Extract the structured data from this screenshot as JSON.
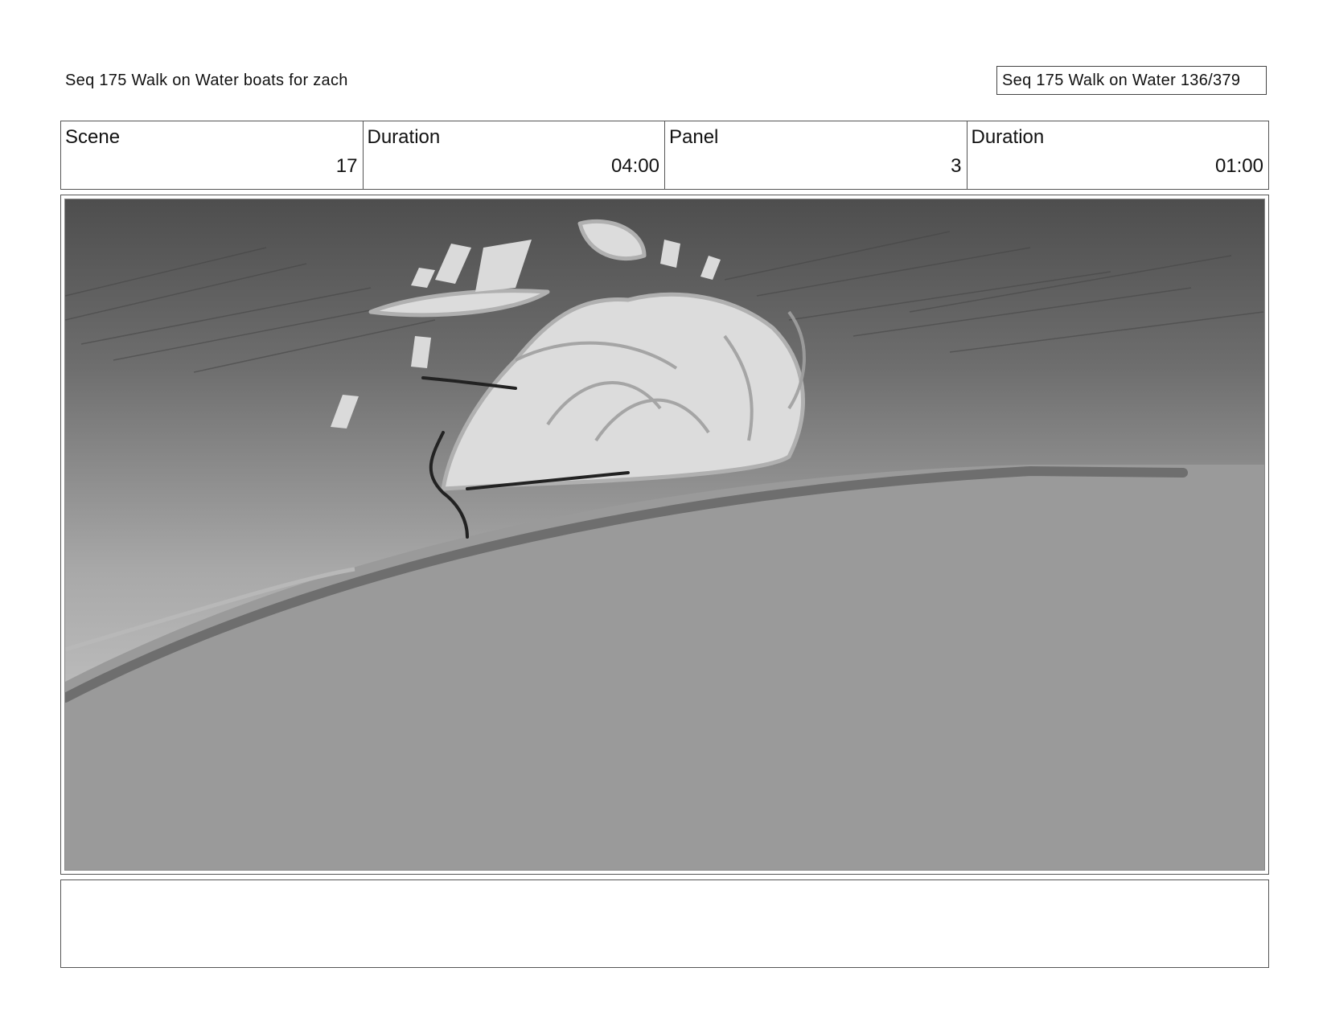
{
  "header": {
    "sequence_title": "Seq 175 Walk on Water  boats for zach",
    "page_counter": "Seq 175 Walk on Water 136/379"
  },
  "info": {
    "scene_label": "Scene",
    "scene_value": "17",
    "scene_duration_label": "Duration",
    "scene_duration_value": "04:00",
    "panel_label": "Panel",
    "panel_value": "3",
    "panel_duration_label": "Duration",
    "panel_duration_value": "01:00"
  },
  "notes": {
    "text": ""
  },
  "colors": {
    "sky_top": "#4e4e4e",
    "sky_bottom": "#d2d2d2",
    "water": "#9a9a9a",
    "wake_light": "#dedede",
    "border": "#555555"
  }
}
